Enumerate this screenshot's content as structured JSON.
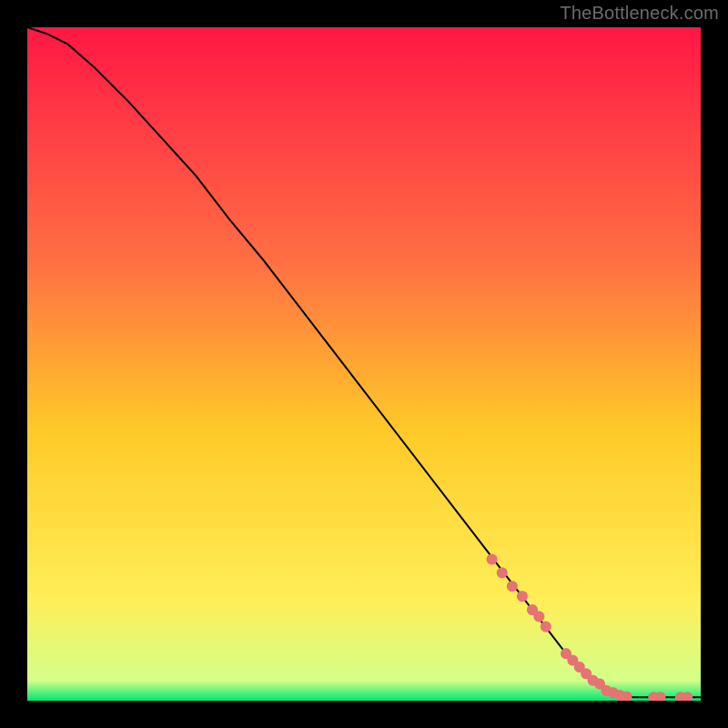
{
  "watermark": "TheBottleneck.com",
  "colors": {
    "bg": "#000000",
    "grad_top": "#ff1744",
    "grad_mid1": "#ff7043",
    "grad_mid2": "#ffca28",
    "grad_mid3": "#ffee58",
    "grad_bottom": "#00e676",
    "curve": "#000000",
    "marker": "#e57373"
  },
  "chart_data": {
    "type": "line",
    "title": "",
    "xlabel": "",
    "ylabel": "",
    "xlim": [
      0,
      100
    ],
    "ylim": [
      0,
      100
    ],
    "series": [
      {
        "name": "curve",
        "x": [
          0,
          3,
          6,
          10,
          15,
          20,
          25,
          30,
          35,
          40,
          45,
          50,
          55,
          60,
          65,
          70,
          75,
          80,
          82,
          84,
          86,
          88,
          90,
          92,
          94,
          96,
          98,
          100
        ],
        "y": [
          100,
          99,
          97.5,
          94,
          89,
          83.5,
          78,
          71.5,
          65.5,
          59,
          52.5,
          46,
          39.5,
          33,
          26.5,
          20,
          13.5,
          7,
          5,
          3,
          1.5,
          0.7,
          0.5,
          0.5,
          0.5,
          0.5,
          0.5,
          0.5
        ]
      }
    ],
    "markers": {
      "name": "highlighted-points",
      "x": [
        69,
        70.5,
        72,
        73.5,
        75,
        76,
        77,
        80,
        81,
        82,
        83,
        84,
        85,
        86,
        87,
        88,
        89,
        93,
        94,
        97,
        98
      ],
      "y": [
        21,
        19,
        17,
        15.5,
        13.5,
        12.5,
        11,
        7,
        6,
        5,
        4,
        3,
        2.5,
        1.5,
        1.2,
        0.8,
        0.6,
        0.5,
        0.5,
        0.5,
        0.5
      ]
    }
  }
}
